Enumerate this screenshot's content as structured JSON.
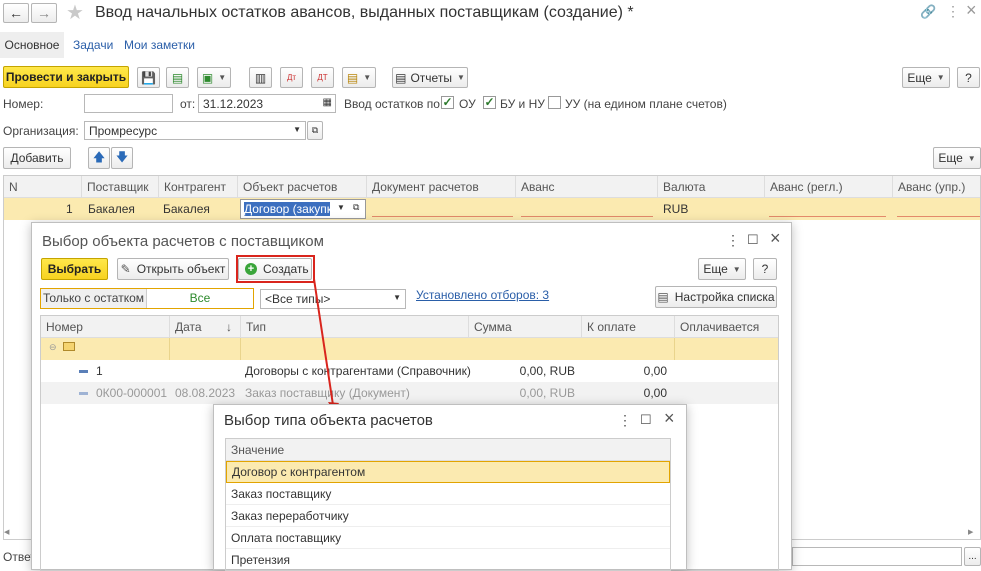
{
  "window": {
    "title": "Ввод начальных остатков авансов, выданных поставщикам (создание) *",
    "more_icon": "⋮",
    "close_icon": "×"
  },
  "tabs": [
    {
      "label": "Основное"
    },
    {
      "label": "Задачи"
    },
    {
      "label": "Мои заметки"
    }
  ],
  "toolbar": {
    "post_close": "Провести и закрыть",
    "reports": "Отчеты",
    "more": "Еще",
    "help": "?"
  },
  "form": {
    "number_label": "Номер:",
    "number_value": "",
    "date_label": "от:",
    "date_value": "31.12.2023",
    "input_label": "Ввод остатков по:",
    "ou": "ОУ",
    "bu_nu": "БУ и НУ",
    "uu": "УУ (на едином плане счетов)",
    "org_label": "Организация:",
    "org_value": "Промресурс"
  },
  "table_toolbar": {
    "add": "Добавить",
    "more": "Еще"
  },
  "table": {
    "columns": [
      "N",
      "Поставщик",
      "Контрагент",
      "Объект расчетов",
      "Документ расчетов",
      "Аванс",
      "Валюта",
      "Аванс (регл.)",
      "Аванс (упр.)"
    ],
    "rows": [
      {
        "n": "1",
        "supplier": "Бакалея",
        "counterparty": "Бакалея",
        "object": "Договор (закупка)",
        "document": "",
        "advance": "",
        "currency": "RUB",
        "advance_regl": "",
        "advance_upr": ""
      }
    ]
  },
  "status": {
    "label": "Ответ"
  },
  "dialog1": {
    "title": "Выбор объекта расчетов с поставщиком",
    "select": "Выбрать",
    "open": "Открыть объект",
    "create": "Создать",
    "more": "Еще",
    "help": "?",
    "filter_left": "Только с остатком",
    "filter_right": "Все",
    "type_value": "<Все типы>",
    "filters_link": "Установлено отборов: 3",
    "list_settings": "Настройка списка",
    "columns": [
      "Номер",
      "Дата",
      "Тип",
      "Сумма",
      "К оплате",
      "Оплачивается"
    ],
    "rows": [
      {
        "number": "1",
        "date": "",
        "type": "Договоры с контрагентами (Справочник)",
        "sum": "0,00, RUB",
        "to_pay": "0,00",
        "paying": ""
      },
      {
        "number": "0К00-000001",
        "date": "08.08.2023",
        "type": "Заказ поставщику (Документ)",
        "sum": "0,00, RUB",
        "to_pay": "0,00",
        "paying": ""
      }
    ]
  },
  "dialog2": {
    "title": "Выбор типа объекта расчетов",
    "header": "Значение",
    "items": [
      "Договор с контрагентом",
      "Заказ поставщику",
      "Заказ переработчику",
      "Оплата поставщику",
      "Претензия"
    ]
  },
  "colors": {
    "accent_yellow": "#f7d220",
    "selection": "#fbeab0",
    "highlight_border": "#e2a400",
    "annotation_red": "#d9251d",
    "link_blue": "#2a5ea8"
  }
}
